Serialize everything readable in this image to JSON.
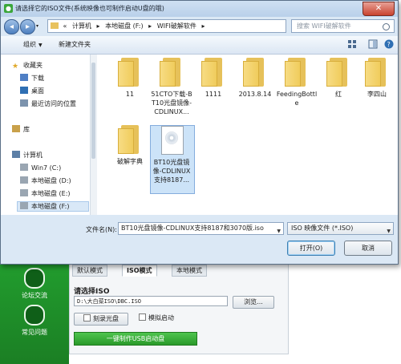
{
  "dialog": {
    "title": "请选择它的ISO文件(系统映像也可制作启动U盘的哦)",
    "close_label": "✕",
    "address": {
      "crumbs": [
        "«",
        "计算机",
        "▸",
        "本地磁盘 (F:)",
        "▸",
        "WIFI破解软件",
        "▸"
      ]
    },
    "search_placeholder": "搜索 WIFI破解软件",
    "toolbar": {
      "organize": "组织",
      "new_folder": "新建文件夹"
    },
    "sidebar": {
      "items": [
        {
          "label": "收藏夹"
        },
        {
          "label": "下载"
        },
        {
          "label": "桌面"
        },
        {
          "label": "最近访问的位置"
        },
        {
          "label": "库"
        },
        {
          "label": "计算机"
        },
        {
          "label": "Win7 (C:)"
        },
        {
          "label": "本地磁盘 (D:)"
        },
        {
          "label": "本地磁盘 (E:)"
        },
        {
          "label": "本地磁盘 (F:)"
        }
      ]
    },
    "files": [
      {
        "name": "11"
      },
      {
        "name": "51CTO下载-BT10光盘镜像-CDLINUX..."
      },
      {
        "name": "1111"
      },
      {
        "name": "2013.8.14"
      },
      {
        "name": "FeedingBottle"
      },
      {
        "name": "红"
      },
      {
        "name": "李四山"
      },
      {
        "name": "破解字典"
      },
      {
        "name": "BT10光盘镜像-CDLINUX支持8187..."
      }
    ],
    "filename_label": "文件名(N):",
    "filename_value": "BT10光盘镜像-CDLINUX支持8187和3070版.iso",
    "filetype_value": "ISO 映像文件 (*.ISO)",
    "open_button": "打开(O)",
    "cancel_button": "取消"
  },
  "background_app": {
    "nav": [
      {
        "label": "论坛交流"
      },
      {
        "label": "常见问题"
      }
    ],
    "tabs": [
      {
        "label": "默认模式"
      },
      {
        "label": "ISO模式"
      },
      {
        "label": "本地模式"
      }
    ],
    "choose_iso_label": "请选择ISO",
    "iso_path": "D:\\大白菜ISO\\DBC.ISO",
    "browse_button": "浏览...",
    "burn_cd_button": "刻录光盘",
    "simulate_button": "模拟启动",
    "make_usb_button": "一键制作USB启动盘"
  }
}
